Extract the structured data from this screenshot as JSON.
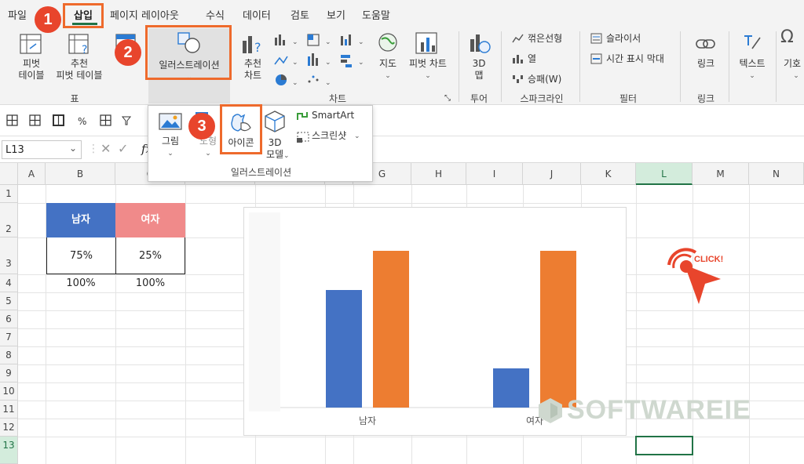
{
  "menubar": {
    "items": [
      "파일",
      "삽입",
      "페이지 레이아웃",
      "수식",
      "데이터",
      "검토",
      "보기",
      "도움말"
    ],
    "active": "삽입"
  },
  "ribbon": {
    "pivot_table": "피벗\n테이블",
    "recommended_pivot": "추천\n피벗 테이블",
    "illustrations": "일러스트레이션",
    "recommended_charts": "추천\n차트",
    "maps": "지도",
    "pivot_chart": "피벗 차트",
    "map3d": "3D\n맵",
    "sparkline_line": "꺾은선형",
    "sparkline_column": "열",
    "sparkline_winloss": "승패(W)",
    "slicer": "슬라이서",
    "timeline": "시간 표시 막대",
    "link": "링크",
    "text": "텍스트",
    "symbol": "기호",
    "groups": {
      "table": "표",
      "charts": "차트",
      "tours": "투어",
      "sparklines": "스파크라인",
      "filters": "필터",
      "links": "링크"
    }
  },
  "dropdown": {
    "picture": "그림",
    "shapes": "도형",
    "icons": "아이콘",
    "model3d": "3D\n모델",
    "smartart": "SmartArt",
    "screenshot": "스크린샷",
    "group_label": "일러스트레이션"
  },
  "namebox": {
    "value": "L13"
  },
  "formula": {
    "fx": "fx"
  },
  "columns": [
    "A",
    "B",
    "C",
    "D",
    "E",
    "F",
    "G",
    "H",
    "I",
    "J",
    "K",
    "L",
    "M",
    "N"
  ],
  "rows": [
    "1",
    "2",
    "3",
    "4",
    "5",
    "6",
    "7",
    "8",
    "9",
    "10",
    "11",
    "12",
    "13"
  ],
  "table": {
    "male_header": "남자",
    "female_header": "여자",
    "male_value": "75%",
    "female_value": "25%",
    "total_male": "100%",
    "total_female": "100%"
  },
  "chart_data": {
    "type": "bar",
    "categories": [
      "남자",
      "여자"
    ],
    "series": [
      {
        "values": [
          75,
          25
        ]
      },
      {
        "values": [
          100,
          100
        ]
      }
    ],
    "ylim": [
      0,
      100
    ]
  },
  "badges": [
    "1",
    "2",
    "3"
  ],
  "watermark": "SOFTWAREIE",
  "click_label": "CLICK!",
  "colors": {
    "accent": "#217346",
    "highlight": "#ee6a2c",
    "badge": "#e8452c",
    "series_blue": "#4472c4",
    "series_orange": "#ed7d31",
    "female_header": "#f08a8a",
    "male_header": "#4472c4"
  }
}
